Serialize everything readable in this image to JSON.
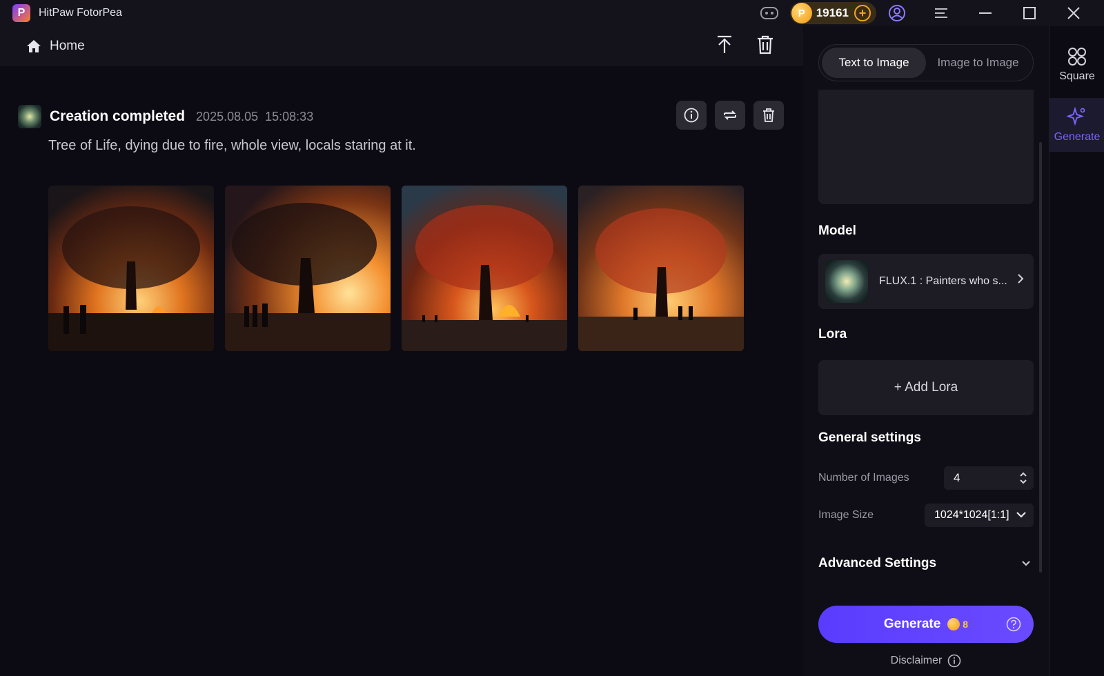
{
  "app": {
    "title": "HitPaw FotorPea",
    "logo_letter": "P"
  },
  "titlebar": {
    "coins": "19161",
    "coin_symbol": "P",
    "coin_add": "+"
  },
  "topbar": {
    "home_label": "Home"
  },
  "creation": {
    "status": "Creation completed",
    "date": "2025.08.05",
    "time": "15:08:33",
    "prompt": "Tree of Life, dying due to fire, whole view, locals staring at it."
  },
  "panel": {
    "tabs": [
      {
        "label": "Text to Image",
        "active": true
      },
      {
        "label": "Image to Image",
        "active": false
      }
    ],
    "model_label": "Model",
    "model_name": "FLUX.1 : Painters who s...",
    "lora_label": "Lora",
    "add_lora": "+ Add Lora",
    "general_label": "General settings",
    "num_images_label": "Number of Images",
    "num_images_value": "4",
    "image_size_label": "Image Size",
    "image_size_value": "1024*1024[1:1]",
    "advanced_label": "Advanced Settings",
    "generate_label": "Generate",
    "generate_cost": "8",
    "disclaimer": "Disclaimer"
  },
  "rail": [
    {
      "label": "Square",
      "icon": "square-grid-icon"
    },
    {
      "label": "Generate",
      "icon": "sparkle-icon"
    }
  ],
  "colors": {
    "accent": "#5a3cff",
    "coin": "#f4a521",
    "bg": "#0c0b13"
  }
}
